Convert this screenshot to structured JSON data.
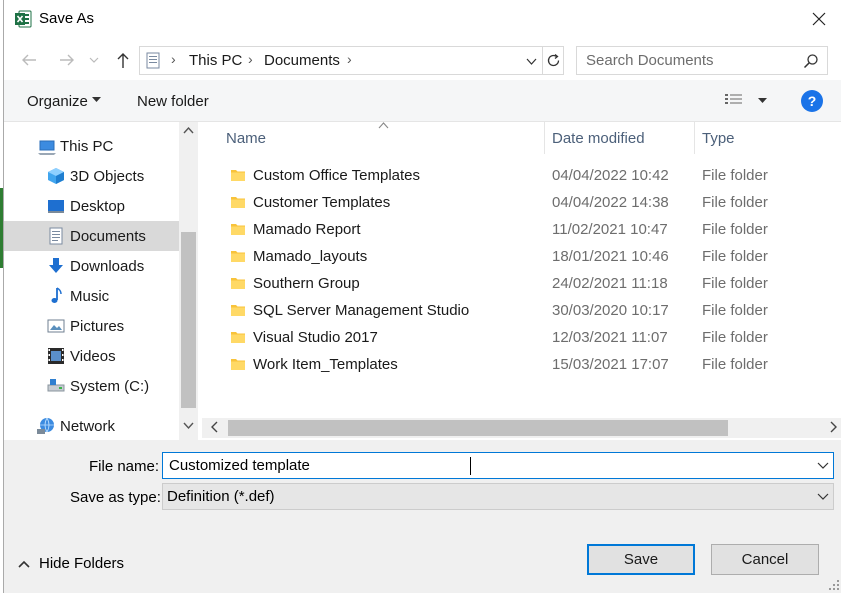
{
  "window": {
    "title": "Save As",
    "close_glyph": "✕"
  },
  "address": {
    "crumbs": [
      "This PC",
      "Documents"
    ],
    "search_placeholder": "Search Documents"
  },
  "toolbar": {
    "organize_label": "Organize",
    "new_folder_label": "New folder",
    "help_label": "?"
  },
  "nav": {
    "items": [
      {
        "label": "This PC",
        "icon": "pc-icon"
      },
      {
        "label": "3D Objects",
        "icon": "cube-icon"
      },
      {
        "label": "Desktop",
        "icon": "desktop-icon"
      },
      {
        "label": "Documents",
        "icon": "documents-icon",
        "selected": true
      },
      {
        "label": "Downloads",
        "icon": "download-icon"
      },
      {
        "label": "Music",
        "icon": "music-icon"
      },
      {
        "label": "Pictures",
        "icon": "pictures-icon"
      },
      {
        "label": "Videos",
        "icon": "videos-icon"
      },
      {
        "label": "System (C:)",
        "icon": "drive-icon"
      },
      {
        "label": "Network",
        "icon": "network-icon"
      }
    ]
  },
  "files": {
    "columns": [
      "Name",
      "Date modified",
      "Type"
    ],
    "rows": [
      {
        "name": "Custom Office Templates",
        "date": "04/04/2022 10:42",
        "type": "File folder"
      },
      {
        "name": "Customer Templates",
        "date": "04/04/2022 14:38",
        "type": "File folder"
      },
      {
        "name": "Mamado Report",
        "date": "11/02/2021 10:47",
        "type": "File folder"
      },
      {
        "name": "Mamado_layouts",
        "date": "18/01/2021 10:46",
        "type": "File folder"
      },
      {
        "name": "Southern Group",
        "date": "24/02/2021 11:18",
        "type": "File folder"
      },
      {
        "name": "SQL Server Management Studio",
        "date": "30/03/2020 10:17",
        "type": "File folder"
      },
      {
        "name": "Visual Studio 2017",
        "date": "12/03/2021 11:07",
        "type": "File folder"
      },
      {
        "name": "Work Item_Templates",
        "date": "15/03/2021 17:07",
        "type": "File folder"
      }
    ]
  },
  "form": {
    "file_name_label": "File name:",
    "file_name_value": "Customized template",
    "save_type_label": "Save as type:",
    "save_type_value": "Definition (*.def)",
    "hide_folders_label": "Hide Folders",
    "save_label": "Save",
    "cancel_label": "Cancel"
  },
  "colors": {
    "accent": "#0078d7",
    "folder": "#f8c33b",
    "excel_green": "#1e7145"
  }
}
